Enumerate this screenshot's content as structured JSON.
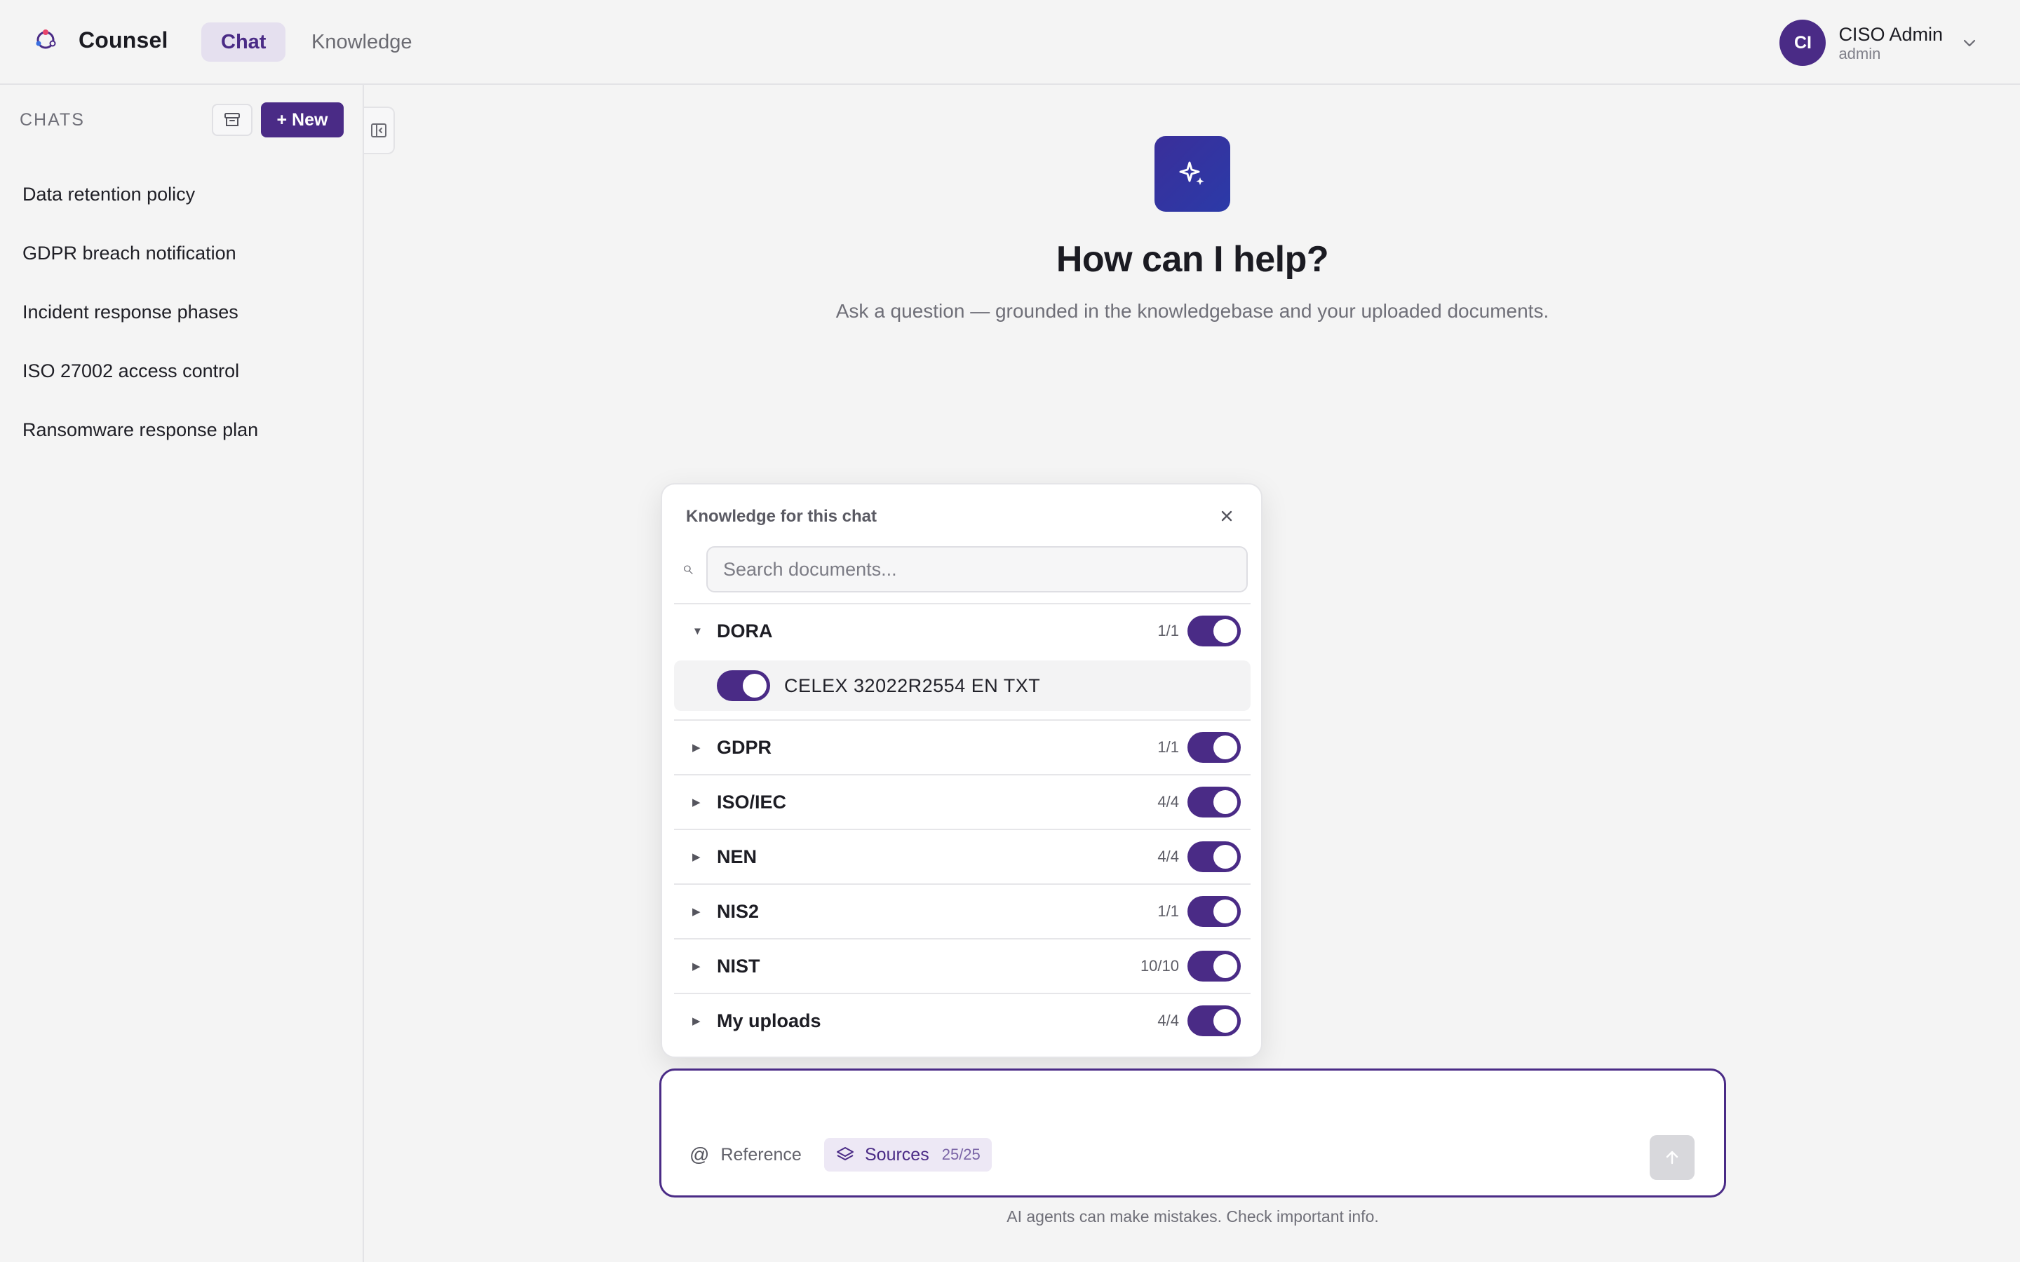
{
  "app": {
    "name": "Counsel"
  },
  "nav": {
    "tabs": [
      {
        "label": "Chat",
        "active": true
      },
      {
        "label": "Knowledge",
        "active": false
      }
    ]
  },
  "user": {
    "initials": "CI",
    "name": "CISO Admin",
    "role": "admin"
  },
  "sidebar": {
    "section_label": "CHATS",
    "new_label": "+ New",
    "chats": [
      "Data retention policy",
      "GDPR breach notification",
      "Incident response phases",
      "ISO 27002 access control",
      "Ransomware response plan"
    ]
  },
  "hero": {
    "title": "How can I help?",
    "subtitle": "Ask a question — grounded in the knowledgebase and your uploaded documents."
  },
  "knowledge_popover": {
    "title": "Knowledge for this chat",
    "search_placeholder": "Search documents...",
    "groups": [
      {
        "name": "DORA",
        "count": "1/1",
        "enabled": true,
        "expanded": true,
        "documents": [
          {
            "name": "CELEX 32022R2554 EN TXT",
            "enabled": true
          }
        ]
      },
      {
        "name": "GDPR",
        "count": "1/1",
        "enabled": true,
        "expanded": false
      },
      {
        "name": "ISO/IEC",
        "count": "4/4",
        "enabled": true,
        "expanded": false
      },
      {
        "name": "NEN",
        "count": "4/4",
        "enabled": true,
        "expanded": false
      },
      {
        "name": "NIS2",
        "count": "1/1",
        "enabled": true,
        "expanded": false
      },
      {
        "name": "NIST",
        "count": "10/10",
        "enabled": true,
        "expanded": false
      },
      {
        "name": "My uploads",
        "count": "4/4",
        "enabled": true,
        "expanded": false
      }
    ]
  },
  "composer": {
    "reference_label": "Reference",
    "sources_label": "Sources",
    "sources_count": "25/25",
    "input_value": ""
  },
  "disclaimer": "AI agents can make mistakes. Check important info.",
  "colors": {
    "accent": "#4a2b86",
    "hero_gradient_start": "#3a2f9a",
    "hero_gradient_end": "#2b3aa8"
  }
}
